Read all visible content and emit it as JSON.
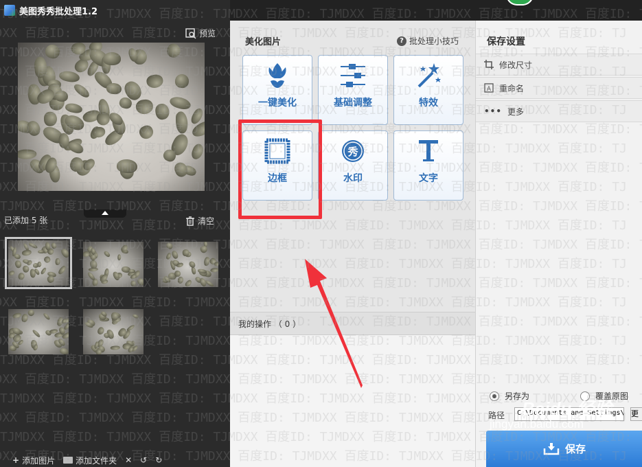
{
  "window": {
    "title": "美图秀秀批处理1.2"
  },
  "left_panel": {
    "preview_label": "预览",
    "added_count": "已添加 5 张",
    "clear_label": "清空",
    "thumbnails": [
      {
        "selected": true
      },
      {
        "selected": false
      },
      {
        "selected": false
      },
      {
        "selected": false
      },
      {
        "selected": false
      }
    ],
    "toolbar": {
      "add_image": "添加图片",
      "add_folder": "添加文件夹"
    }
  },
  "middle_panel": {
    "heading": "美化图片",
    "tips": "批处理小技巧",
    "tools": [
      {
        "label": "一键美化",
        "icon": "tulip-icon"
      },
      {
        "label": "基础调整",
        "icon": "sliders-icon"
      },
      {
        "label": "特效",
        "icon": "magic-wand-icon"
      },
      {
        "label": "边框",
        "icon": "frame-icon"
      },
      {
        "label": "水印",
        "icon": "watermark-icon"
      },
      {
        "label": "文字",
        "icon": "text-t-icon"
      }
    ],
    "my_ops": "我的操作 （ 0 ）"
  },
  "right_panel": {
    "heading": "保存设置",
    "options": [
      "修改尺寸",
      "重命名",
      "更多"
    ],
    "save_as": "另存为",
    "overwrite": "覆盖原图",
    "save_as_selected": true,
    "path_label": "路径",
    "path_value": "C:\\Documents and Settings\\",
    "change_label": "更",
    "save_button": "保存"
  },
  "watermark": {
    "text": "TJMDXX 百度ID: TJMDXX 百度ID: TJMDXX 百度ID: TJMDXX 百度ID: TJMDXX 百度ID: TJMDXX 百度ID: TJ",
    "baidu": "Baidu 经验",
    "site": "jingyan.baidu.com"
  },
  "colors": {
    "accent": "#2f6fb6",
    "highlight": "#f0313a",
    "save": "#2c7bd6"
  }
}
